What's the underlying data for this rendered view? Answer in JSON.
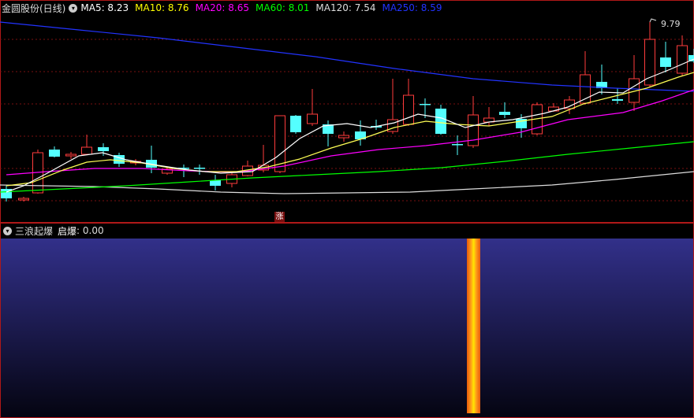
{
  "main": {
    "title": "金圆股份(日线)",
    "collapse_icon": "chevron-down-icon",
    "ma_labels": [
      {
        "label": "MA5: 8.23",
        "color": "#ffffff"
      },
      {
        "label": "MA10: 8.76",
        "color": "#ffff00"
      },
      {
        "label": "MA20: 8.65",
        "color": "#ff00ff"
      },
      {
        "label": "MA60: 8.01",
        "color": "#00ff00"
      },
      {
        "label": "MA120: 7.54",
        "color": "#dddddd"
      },
      {
        "label": "MA250: 8.59",
        "color": "#2233ff"
      }
    ],
    "max_price_label": "9.79",
    "rise_flag": "涨",
    "colors": {
      "up": "#ff3c3c",
      "down": "#54ffff",
      "grid": "#7a1010",
      "frame": "#b01818"
    }
  },
  "indicator": {
    "name": "三浪起爆",
    "field_label": "启爆",
    "field_value": "0.00",
    "collapse_icon": "chevron-down-icon",
    "colors": {
      "bg_top": "#32308a",
      "bg_bottom": "#040410",
      "bar_outer": "#ff9b1a",
      "bar_inner": "#ffe600"
    }
  }
}
